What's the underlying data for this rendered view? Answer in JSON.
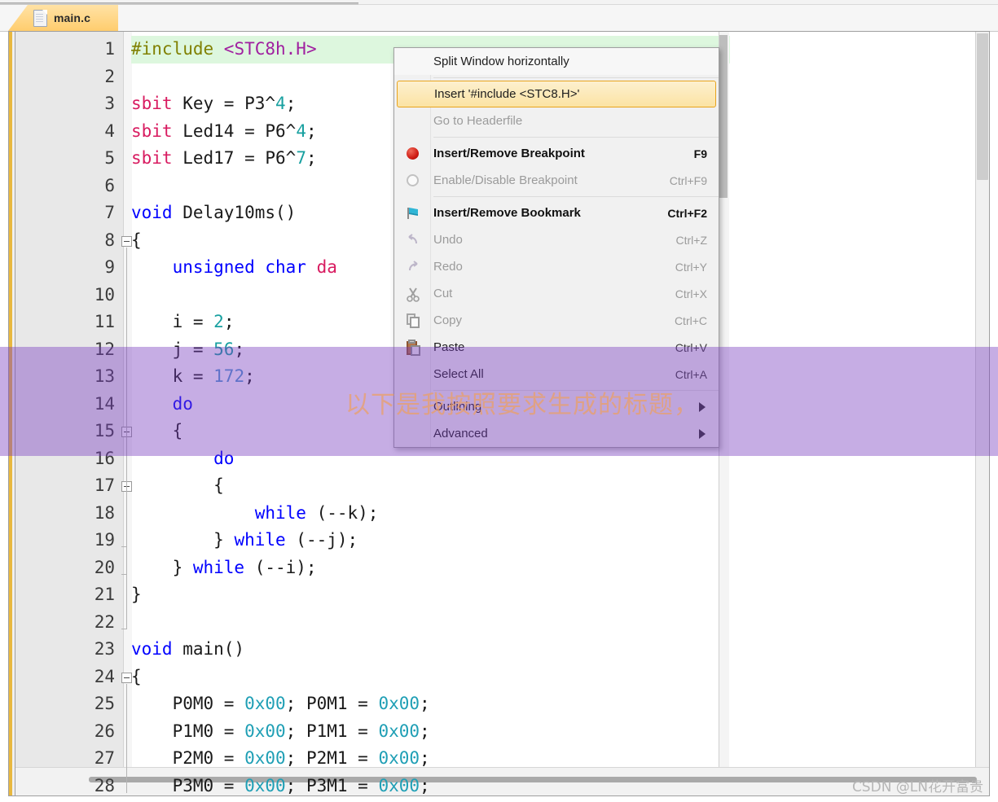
{
  "window": {
    "tab": {
      "label": "main.c",
      "icon": "file-icon"
    }
  },
  "editor": {
    "lines": [
      {
        "n": "1",
        "tokens": [
          {
            "t": "#include ",
            "c": "pp"
          },
          {
            "t": "<STC8h.H>",
            "c": "inc"
          }
        ],
        "highlight": true,
        "indent": 0
      },
      {
        "n": "2",
        "tokens": [],
        "highlight": false
      },
      {
        "n": "3",
        "tokens": [
          {
            "t": "sbit",
            "c": "sbit"
          },
          {
            "t": " Key = P3",
            "c": "plain"
          },
          {
            "t": "^",
            "c": "plain"
          },
          {
            "t": "4",
            "c": "num"
          },
          {
            "t": ";",
            "c": "plain"
          }
        ]
      },
      {
        "n": "4",
        "tokens": [
          {
            "t": "sbit",
            "c": "sbit"
          },
          {
            "t": " Led14 = P6",
            "c": "plain"
          },
          {
            "t": "^",
            "c": "plain"
          },
          {
            "t": "4",
            "c": "num"
          },
          {
            "t": ";",
            "c": "plain"
          }
        ]
      },
      {
        "n": "5",
        "tokens": [
          {
            "t": "sbit",
            "c": "sbit"
          },
          {
            "t": " Led17 = P6",
            "c": "plain"
          },
          {
            "t": "^",
            "c": "plain"
          },
          {
            "t": "7",
            "c": "num"
          },
          {
            "t": ";",
            "c": "plain"
          }
        ]
      },
      {
        "n": "6",
        "tokens": []
      },
      {
        "n": "7",
        "tokens": [
          {
            "t": "void",
            "c": "type"
          },
          {
            "t": " Delay10ms()",
            "c": "plain"
          }
        ]
      },
      {
        "n": "8",
        "tokens": [
          {
            "t": "{",
            "c": "plain"
          }
        ],
        "fold": "start"
      },
      {
        "n": "9",
        "tokens": [
          {
            "t": "    ",
            "c": "plain"
          },
          {
            "t": "unsigned char",
            "c": "type"
          },
          {
            "t": " da",
            "c": "sbit"
          }
        ]
      },
      {
        "n": "10",
        "tokens": []
      },
      {
        "n": "11",
        "tokens": [
          {
            "t": "    i = ",
            "c": "plain"
          },
          {
            "t": "2",
            "c": "num"
          },
          {
            "t": ";",
            "c": "plain"
          }
        ]
      },
      {
        "n": "12",
        "tokens": [
          {
            "t": "    j = ",
            "c": "plain"
          },
          {
            "t": "56",
            "c": "num"
          },
          {
            "t": ";",
            "c": "plain"
          }
        ]
      },
      {
        "n": "13",
        "tokens": [
          {
            "t": "    k = ",
            "c": "plain"
          },
          {
            "t": "172",
            "c": "num2"
          },
          {
            "t": ";",
            "c": "plain"
          }
        ]
      },
      {
        "n": "14",
        "tokens": [
          {
            "t": "    ",
            "c": "plain"
          },
          {
            "t": "do",
            "c": "kw"
          }
        ]
      },
      {
        "n": "15",
        "tokens": [
          {
            "t": "    {",
            "c": "plain"
          }
        ],
        "fold": "start"
      },
      {
        "n": "16",
        "tokens": [
          {
            "t": "        ",
            "c": "plain"
          },
          {
            "t": "do",
            "c": "kw"
          }
        ]
      },
      {
        "n": "17",
        "tokens": [
          {
            "t": "        {",
            "c": "plain"
          }
        ],
        "fold": "start"
      },
      {
        "n": "18",
        "tokens": [
          {
            "t": "            ",
            "c": "plain"
          },
          {
            "t": "while",
            "c": "kw"
          },
          {
            "t": " (--k);",
            "c": "plain"
          }
        ]
      },
      {
        "n": "19",
        "tokens": [
          {
            "t": "        } ",
            "c": "plain"
          },
          {
            "t": "while",
            "c": "kw"
          },
          {
            "t": " (--j);",
            "c": "plain"
          }
        ],
        "fold": "end"
      },
      {
        "n": "20",
        "tokens": [
          {
            "t": "    } ",
            "c": "plain"
          },
          {
            "t": "while",
            "c": "kw"
          },
          {
            "t": " (--i);",
            "c": "plain"
          }
        ],
        "fold": "end"
      },
      {
        "n": "21",
        "tokens": [
          {
            "t": "}",
            "c": "plain"
          }
        ]
      },
      {
        "n": "22",
        "tokens": [],
        "fold": "end"
      },
      {
        "n": "23",
        "tokens": [
          {
            "t": "void",
            "c": "type"
          },
          {
            "t": " main()",
            "c": "plain"
          }
        ]
      },
      {
        "n": "24",
        "tokens": [
          {
            "t": "{",
            "c": "plain"
          }
        ],
        "fold": "start"
      },
      {
        "n": "25",
        "tokens": [
          {
            "t": "    P0M0 = ",
            "c": "plain"
          },
          {
            "t": "0x00",
            "c": "hex"
          },
          {
            "t": "; P0M1 = ",
            "c": "plain"
          },
          {
            "t": "0x00",
            "c": "hex"
          },
          {
            "t": ";",
            "c": "plain"
          }
        ]
      },
      {
        "n": "26",
        "tokens": [
          {
            "t": "    P1M0 = ",
            "c": "plain"
          },
          {
            "t": "0x00",
            "c": "hex"
          },
          {
            "t": "; P1M1 = ",
            "c": "plain"
          },
          {
            "t": "0x00",
            "c": "hex"
          },
          {
            "t": ";",
            "c": "plain"
          }
        ]
      },
      {
        "n": "27",
        "tokens": [
          {
            "t": "    P2M0 = ",
            "c": "plain"
          },
          {
            "t": "0x00",
            "c": "hex"
          },
          {
            "t": "; P2M1 = ",
            "c": "plain"
          },
          {
            "t": "0x00",
            "c": "hex"
          },
          {
            "t": ";",
            "c": "plain"
          }
        ]
      },
      {
        "n": "28",
        "tokens": [
          {
            "t": "    P3M0 = ",
            "c": "plain"
          },
          {
            "t": "0x00",
            "c": "hex"
          },
          {
            "t": "; P3M1 = ",
            "c": "plain"
          },
          {
            "t": "0x00",
            "c": "hex"
          },
          {
            "t": ";",
            "c": "plain"
          }
        ]
      }
    ]
  },
  "context_menu": {
    "items": [
      {
        "type": "item",
        "label": "Split Window horizontally",
        "shortcut": "",
        "icon": "",
        "state": "normal",
        "white": true
      },
      {
        "type": "separator"
      },
      {
        "type": "item",
        "label": "Insert '#include <STC8.H>'",
        "shortcut": "",
        "icon": "",
        "state": "highlight"
      },
      {
        "type": "item",
        "label": "Go to Headerfile",
        "shortcut": "",
        "icon": "",
        "state": "disabled"
      },
      {
        "type": "separator"
      },
      {
        "type": "item",
        "label": "Insert/Remove Breakpoint",
        "shortcut": "F9",
        "icon": "breakpoint-icon",
        "state": "bold"
      },
      {
        "type": "item",
        "label": "Enable/Disable Breakpoint",
        "shortcut": "Ctrl+F9",
        "icon": "breakpoint-off-icon",
        "state": "disabled"
      },
      {
        "type": "separator"
      },
      {
        "type": "item",
        "label": "Insert/Remove Bookmark",
        "shortcut": "Ctrl+F2",
        "icon": "bookmark-icon",
        "state": "bold"
      },
      {
        "type": "item",
        "label": "Undo",
        "shortcut": "Ctrl+Z",
        "icon": "undo-icon",
        "state": "disabled"
      },
      {
        "type": "item",
        "label": "Redo",
        "shortcut": "Ctrl+Y",
        "icon": "redo-icon",
        "state": "disabled"
      },
      {
        "type": "item",
        "label": "Cut",
        "shortcut": "Ctrl+X",
        "icon": "cut-icon",
        "state": "disabled"
      },
      {
        "type": "item",
        "label": "Copy",
        "shortcut": "Ctrl+C",
        "icon": "copy-icon",
        "state": "disabled"
      },
      {
        "type": "item",
        "label": "Paste",
        "shortcut": "Ctrl+V",
        "icon": "paste-icon",
        "state": "normal"
      },
      {
        "type": "item",
        "label": "Select All",
        "shortcut": "Ctrl+A",
        "icon": "",
        "state": "normal"
      },
      {
        "type": "separator"
      },
      {
        "type": "submenu",
        "label": "Outlining",
        "shortcut": "",
        "icon": "",
        "state": "normal"
      },
      {
        "type": "submenu",
        "label": "Advanced",
        "shortcut": "",
        "icon": "",
        "state": "normal"
      }
    ]
  },
  "overlay": {
    "title_text": "以下是我按照要求生成的标题，",
    "title_color": "#eca064",
    "band_color": "#783cbe"
  },
  "watermark": {
    "text": "CSDN @LN花开富贵"
  },
  "colors": {
    "tab_accent": "#ffcd6e",
    "highlight_line": "#ddf7de",
    "menu_highlight_border": "#e8a31d",
    "gutter": "#e8e8e8"
  }
}
